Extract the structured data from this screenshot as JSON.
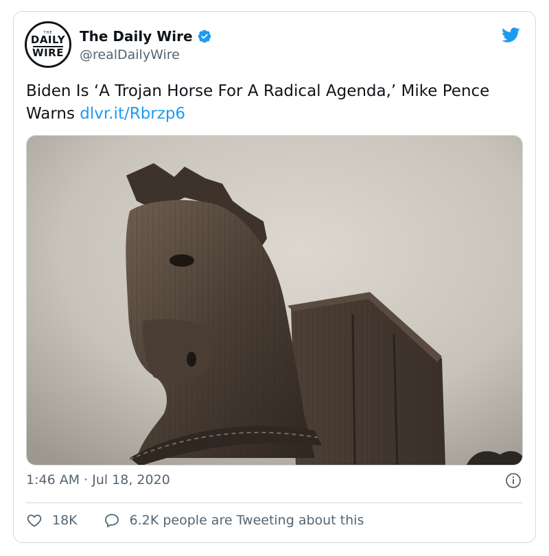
{
  "tweet": {
    "author": {
      "name": "The Daily Wire",
      "handle": "@realDailyWire",
      "avatar_text": {
        "the": "THE",
        "line1": "DAILY",
        "line2": "WIRE"
      },
      "verified": true
    },
    "text": "Biden Is ‘A Trojan Horse For A Radical Agenda,’ Mike Pence Warns ",
    "link": "dlvr.it/Rbrzp6",
    "media": {
      "icon": "trojan-horse-photo"
    },
    "timestamp": "1:46 AM · Jul 18, 2020",
    "likes": "18K",
    "conversation": "6.2K people are Tweeting about this"
  },
  "colors": {
    "accent": "#1d9bf0",
    "text_primary": "#0f1419",
    "text_secondary": "#536471",
    "border": "#cfd9de"
  },
  "icons": {
    "bird": "twitter-bird-icon",
    "verified": "verified-badge-icon",
    "info": "info-icon",
    "like": "heart-icon",
    "reply": "speech-bubble-icon"
  }
}
